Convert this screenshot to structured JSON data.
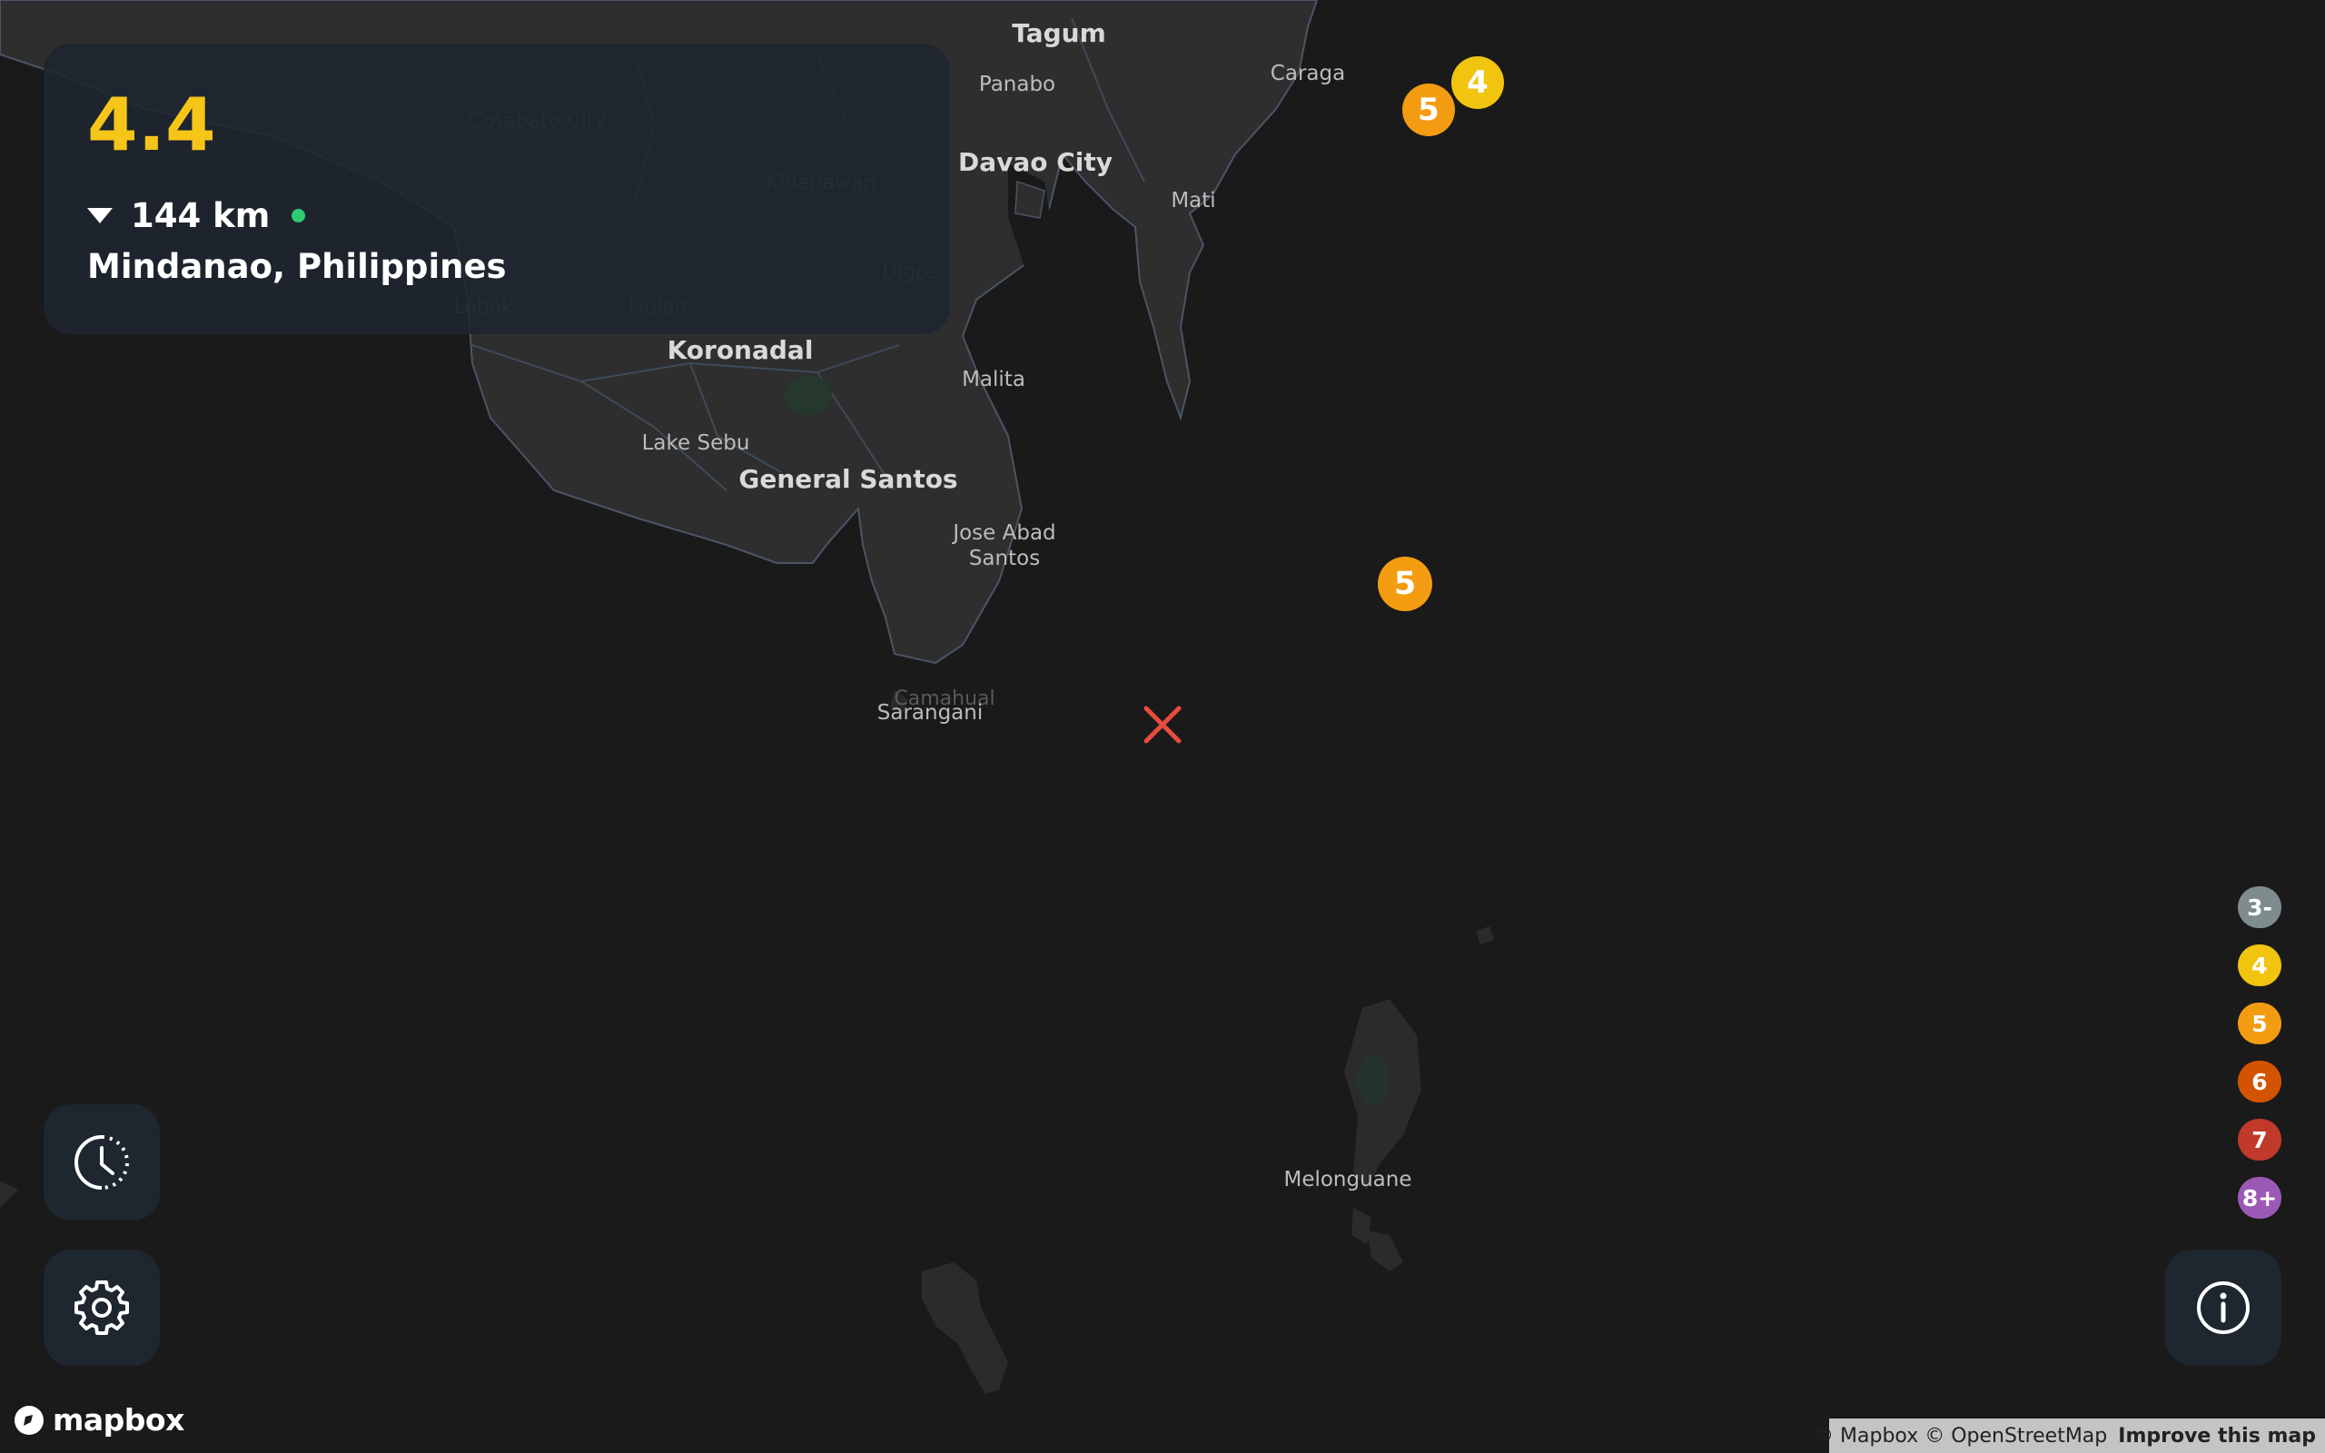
{
  "map": {
    "places": [
      {
        "name": "Tagum",
        "cls": "major"
      },
      {
        "name": "Panabo",
        "cls": ""
      },
      {
        "name": "Davao City",
        "cls": "major"
      },
      {
        "name": "Caraga",
        "cls": ""
      },
      {
        "name": "Mati",
        "cls": ""
      },
      {
        "name": "Cotabato City",
        "cls": "faint"
      },
      {
        "name": "Kidapawan",
        "cls": "faint"
      },
      {
        "name": "Digos",
        "cls": "faint"
      },
      {
        "name": "Lebak",
        "cls": "faint"
      },
      {
        "name": "Isulan",
        "cls": "faint"
      },
      {
        "name": "Koronadal",
        "cls": "major"
      },
      {
        "name": "Malita",
        "cls": ""
      },
      {
        "name": "Lake Sebu",
        "cls": ""
      },
      {
        "name": "General Santos",
        "cls": "major"
      },
      {
        "name": "Jose Abad",
        "cls": ""
      },
      {
        "name": "Santos",
        "cls": ""
      },
      {
        "name": "Camahual",
        "cls": "faint"
      },
      {
        "name": "Sarangani",
        "cls": ""
      },
      {
        "name": "Melonguane",
        "cls": ""
      }
    ],
    "markers": [
      {
        "label": "5",
        "color": "#f39c12"
      },
      {
        "label": "4",
        "color": "#f1c40f"
      },
      {
        "label": "5",
        "color": "#f39c12"
      }
    ],
    "selected_marker_color": "#e74c3c"
  },
  "panel": {
    "magnitude": "4.4",
    "magnitude_color": "#f5c518",
    "depth": "144 km",
    "status_color": "#2ecc71",
    "location": "Mindanao, Philippines"
  },
  "controls": {
    "history_icon": "clock-history-icon",
    "settings_icon": "gear-icon",
    "info_icon": "info-icon"
  },
  "legend": [
    {
      "label": "3-",
      "color": "#7f8c8d"
    },
    {
      "label": "4",
      "color": "#f1c40f"
    },
    {
      "label": "5",
      "color": "#f39c12"
    },
    {
      "label": "6",
      "color": "#d35400"
    },
    {
      "label": "7",
      "color": "#c0392b"
    },
    {
      "label": "8+",
      "color": "#9b59b6"
    }
  ],
  "branding": {
    "logo_text": "mapbox"
  },
  "attribution": {
    "text": "© Mapbox © OpenStreetMap",
    "improve": "Improve this map"
  }
}
